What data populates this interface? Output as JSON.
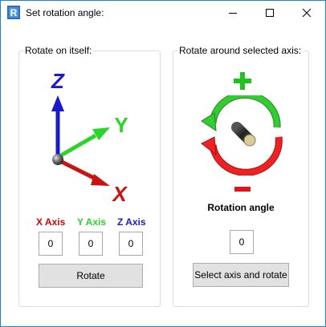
{
  "window": {
    "title": "Set rotation angle:",
    "icon": "R"
  },
  "left_group": {
    "title": "Rotate on itself:",
    "axis_glyphs": {
      "x": "X",
      "y": "Y",
      "z": "Z"
    },
    "axis_labels": {
      "x": "X Axis",
      "y": "Y Axis",
      "z": "Z Axis"
    },
    "axis_values": {
      "x": "0",
      "y": "0",
      "z": "0"
    },
    "rotate_button": "Rotate"
  },
  "right_group": {
    "title": "Rotate around selected axis:",
    "plus_symbol": "+",
    "minus_symbol": "-",
    "rotation_angle_label": "Rotation angle",
    "rotation_angle_value": "0",
    "select_button": "Select axis and rotate"
  },
  "colors": {
    "x_axis": "#e00000",
    "y_axis": "#2bd42b",
    "z_axis": "#1a1acc",
    "plus": "#22c022",
    "minus": "#ee1111",
    "window_border": "#1883d7"
  },
  "icons": [
    "app-r-icon",
    "minimize-icon",
    "maximize-icon",
    "close-icon",
    "xyz-axes-icon",
    "rotation-arrows-icon"
  ]
}
